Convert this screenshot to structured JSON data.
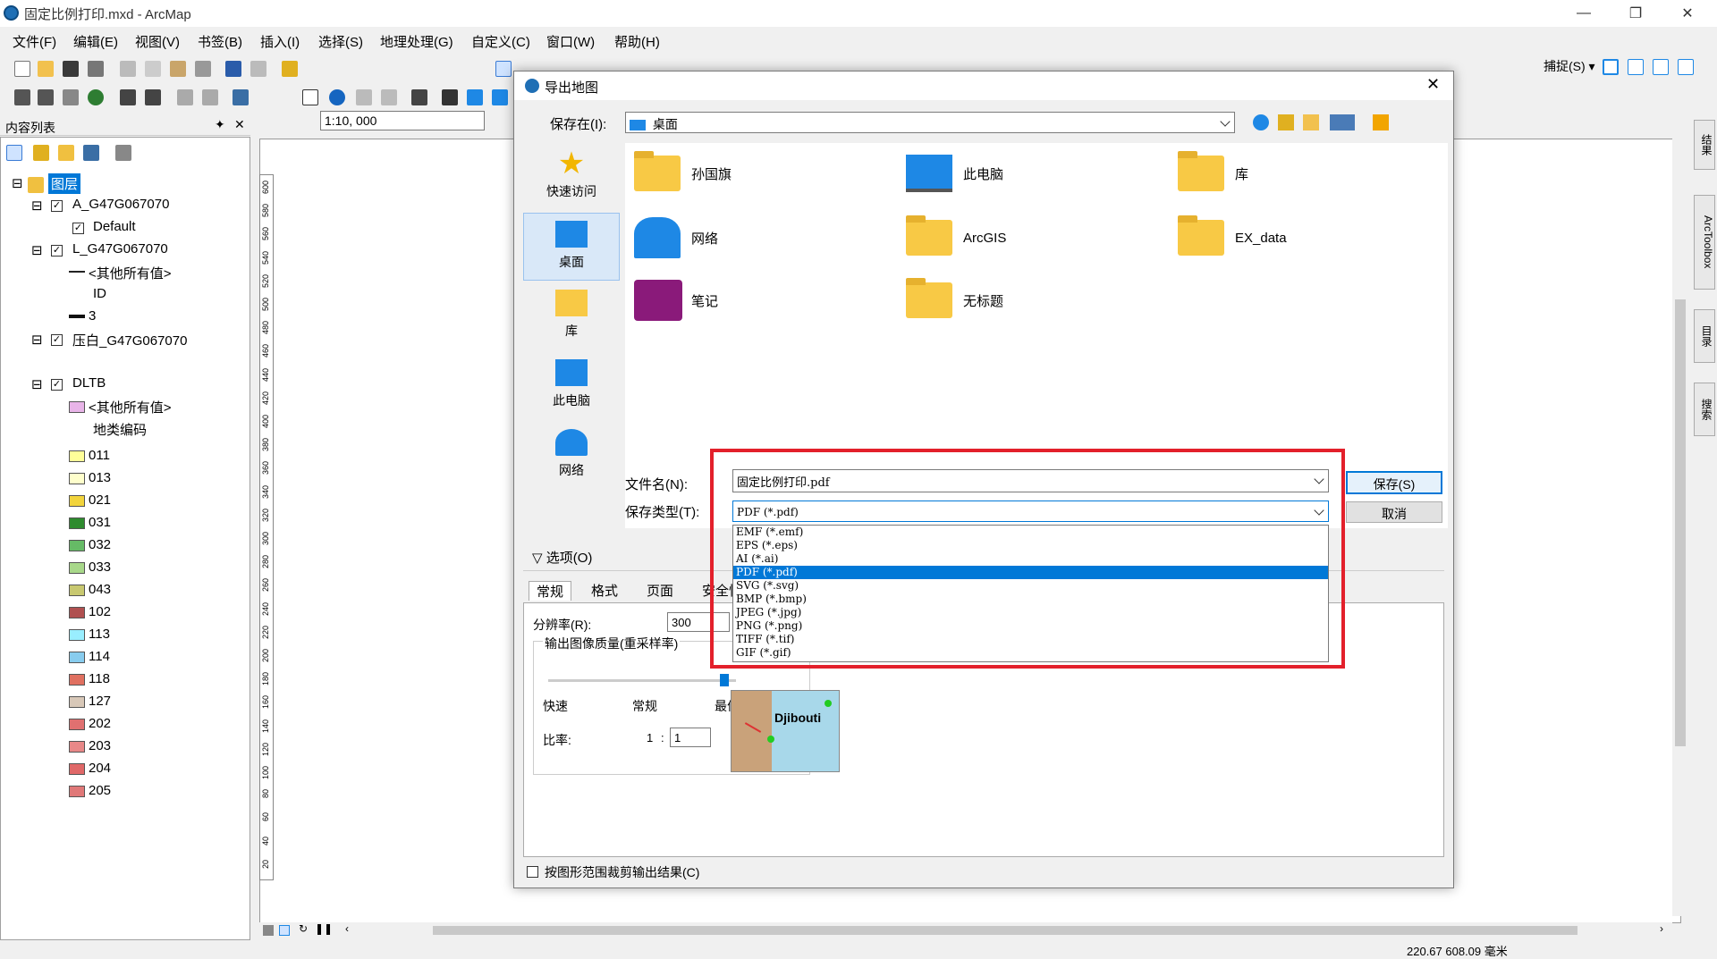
{
  "app": {
    "title": "固定比例打印.mxd - ArcMap",
    "window_controls": [
      "—",
      "❐",
      "✕"
    ]
  },
  "menu": [
    "文件(F)",
    "编辑(E)",
    "视图(V)",
    "书签(B)",
    "插入(I)",
    "选择(S)",
    "地理处理(G)",
    "自定义(C)",
    "窗口(W)",
    "帮助(H)"
  ],
  "toolbar": {
    "scale": "1:10, 000",
    "snapping": "捕捉(S) ▾"
  },
  "toc": {
    "title": "内容列表",
    "root": "图层",
    "layers": [
      {
        "name": "A_G47G067070",
        "sub": "Default"
      },
      {
        "name": "L_G47G067070",
        "sub": "<其他所有值>",
        "field": "ID",
        "value": "3"
      },
      {
        "name": "压白_G47G067070"
      },
      {
        "name": "DLTB",
        "sub": "<其他所有值>",
        "field": "地类编码"
      }
    ],
    "codes": [
      {
        "code": "011",
        "color": "#ffff99"
      },
      {
        "code": "013",
        "color": "#ffffcc"
      },
      {
        "code": "021",
        "color": "#f2d43c"
      },
      {
        "code": "031",
        "color": "#2e8b2e"
      },
      {
        "code": "032",
        "color": "#66bb66"
      },
      {
        "code": "033",
        "color": "#a8d88a"
      },
      {
        "code": "043",
        "color": "#c8c870"
      },
      {
        "code": "102",
        "color": "#b05050"
      },
      {
        "code": "113",
        "color": "#99eeff"
      },
      {
        "code": "114",
        "color": "#88ccee"
      },
      {
        "code": "118",
        "color": "#e07060"
      },
      {
        "code": "127",
        "color": "#d8c8b8"
      },
      {
        "code": "202",
        "color": "#e07070"
      },
      {
        "code": "203",
        "color": "#e88888"
      },
      {
        "code": "204",
        "color": "#e06868"
      },
      {
        "code": "205",
        "color": "#e07878"
      }
    ]
  },
  "ruler_labels": [
    "600",
    "580",
    "560",
    "540",
    "520",
    "500",
    "480",
    "460",
    "440",
    "420",
    "400",
    "380",
    "360",
    "340",
    "320",
    "300",
    "280",
    "260",
    "240",
    "220",
    "200",
    "180",
    "160",
    "140",
    "120",
    "100",
    "80",
    "60",
    "40",
    "20"
  ],
  "side_tabs": [
    "结果",
    "ArcToolbox",
    "目录",
    "搜索"
  ],
  "status": {
    "coords": "220.67  608.09 毫米"
  },
  "dialog": {
    "title": "导出地图",
    "save_in_label": "保存在(I):",
    "save_in_value": "桌面",
    "places": [
      "快速访问",
      "桌面",
      "库",
      "此电脑",
      "网络"
    ],
    "files": [
      "孙国旗",
      "此电脑",
      "库",
      "网络",
      "ArcGIS",
      "EX_data",
      "笔记",
      "无标题"
    ],
    "filename_label": "文件名(N):",
    "filename_value": "固定比例打印.pdf",
    "filetype_label": "保存类型(T):",
    "filetype_value": "PDF (*.pdf)",
    "save_button": "保存(S)",
    "cancel_button": "取消",
    "filetypes": [
      "EMF (*.emf)",
      "EPS (*.eps)",
      "AI (*.ai)",
      "PDF (*.pdf)",
      "SVG (*.svg)",
      "BMP (*.bmp)",
      "JPEG (*.jpg)",
      "PNG (*.png)",
      "TIFF (*.tif)",
      "GIF (*.gif)"
    ],
    "selected_filetype": "PDF (*.pdf)",
    "options_label": "选项(O)",
    "tabs": [
      "常规",
      "格式",
      "页面",
      "安全性"
    ],
    "resolution_label": "分辨率(R):",
    "resolution_value": "300",
    "quality_label": "输出图像质量(重采样率)",
    "quality_ticks": [
      "快速",
      "常规",
      "最佳"
    ],
    "ratio_label": "比率:",
    "ratio_prefix": "1",
    "ratio_sep": ":",
    "ratio_value": "1",
    "preview_label": "Djibouti",
    "clip_label": "按图形范围裁剪输出结果(C)"
  }
}
